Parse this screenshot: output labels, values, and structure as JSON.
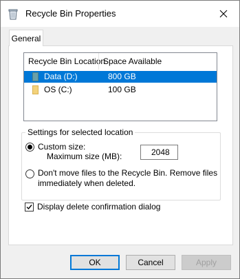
{
  "window": {
    "title": "Recycle Bin Properties",
    "icon": "recycle-bin-icon"
  },
  "tabs": [
    {
      "label": "General",
      "selected": true
    }
  ],
  "locations": {
    "columns": [
      "Recycle Bin Location",
      "Space Available"
    ],
    "rows": [
      {
        "name": "Data (D:)",
        "space": "800 GB",
        "selected": true,
        "icon": "drive-icon",
        "icon_color": "#6aa0a8"
      },
      {
        "name": "OS (C:)",
        "space": "100 GB",
        "selected": false,
        "icon": "drive-icon",
        "icon_color": "#f3d27a"
      }
    ]
  },
  "settings": {
    "group_label": "Settings for selected location",
    "custom_size_label": "Custom size:",
    "custom_size_checked": true,
    "max_size_label": "Maximum size (MB):",
    "max_size_value": "2048",
    "dont_move_label_line1": "Don't move files to the Recycle Bin. Remove files",
    "dont_move_label_line2": "immediately when deleted.",
    "dont_move_checked": false
  },
  "confirm_dialog": {
    "label": "Display delete confirmation dialog",
    "checked": true
  },
  "buttons": {
    "ok": "OK",
    "cancel": "Cancel",
    "apply": "Apply"
  },
  "colors": {
    "selection": "#0078d7",
    "default_button_border": "#0078d7"
  }
}
